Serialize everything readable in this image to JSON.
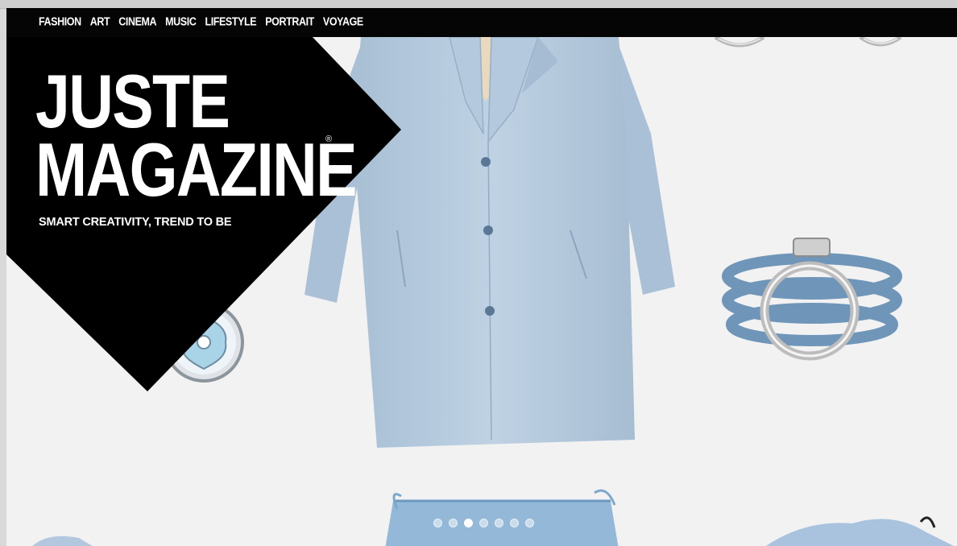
{
  "nav": {
    "items": [
      {
        "label": "FASHION"
      },
      {
        "label": "ART"
      },
      {
        "label": "CINEMA"
      },
      {
        "label": "MUSIC"
      },
      {
        "label": "LIFESTYLE"
      },
      {
        "label": "PORTRAIT"
      },
      {
        "label": "VOYAGE"
      }
    ]
  },
  "brand": {
    "line1": "JUSTE",
    "line2": "MAGAZINE",
    "registered": "®",
    "tagline": "SMART CREATIVITY, TREND TO BE"
  },
  "slider": {
    "slide_count": 7,
    "active_index": 2
  },
  "colors": {
    "nav_bg": "#050505",
    "logo_bg": "#000000",
    "coat": "#b9cde0",
    "accessory_blue": "#6f95b8",
    "silver": "#c8c8c8",
    "page_bg": "#f2f2f2"
  }
}
